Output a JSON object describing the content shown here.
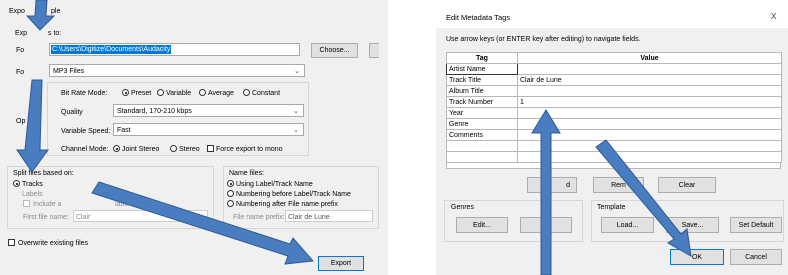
{
  "export_dialog": {
    "title_visible": "Expo",
    "title_tail": "ple",
    "export_to_label_visible": "Exp",
    "export_to_label_tail": "s to:",
    "path_value": "C:\\Users\\Digitize\\Documents\\Audacity",
    "choose_button": "Choose...",
    "format_label": "Fo",
    "format_value": "MP3 Files",
    "format_label_2": "Fo",
    "options_label": "Op",
    "bitrate_label": "Bit Rate Mode:",
    "bitrate_options": [
      "Preset",
      "Variable",
      "Average",
      "Constant"
    ],
    "quality_label": "Quality",
    "quality_value": "Standard, 170-210 kbps",
    "speed_label": "Variable Speed:",
    "speed_value": "Fast",
    "channel_label": "Channel Mode:",
    "channel_options": [
      "Joint Stereo",
      "Stereo"
    ],
    "force_mono_label": "Force export to mono",
    "split_label": "Split files based on:",
    "split_tracks": "Tracks",
    "split_labels": "Labels",
    "include_label": "Include a",
    "include_label_tail": "label",
    "first_file_name_label": "First file name:",
    "first_file_name_value": "Clair",
    "name_files_label": "Name files:",
    "name_options": [
      "Using Label/Track Name",
      "Numbering before Label/Track Name",
      "Numbering after File name prefix"
    ],
    "prefix_label": "File name prefix:",
    "prefix_value": "Clair de Lune",
    "overwrite_label": "Overwrite existing files",
    "export_button": "Export"
  },
  "metadata_dialog": {
    "title": "Edit Metadata Tags",
    "close_symbol": "X",
    "instruction": "Use arrow keys (or ENTER key after editing) to navigate fields.",
    "columns": [
      "Tag",
      "Value"
    ],
    "rows": [
      {
        "tag": "Artist Name",
        "value": ""
      },
      {
        "tag": "Track Title",
        "value": "Clair de Lune"
      },
      {
        "tag": "Album Title",
        "value": ""
      },
      {
        "tag": "Track Number",
        "value": "1"
      },
      {
        "tag": "Year",
        "value": ""
      },
      {
        "tag": "Genre",
        "value": ""
      },
      {
        "tag": "Comments",
        "value": ""
      },
      {
        "tag": "",
        "value": ""
      },
      {
        "tag": "",
        "value": ""
      }
    ],
    "add_button_partial": "d",
    "remove_button_partial": "Rem",
    "clear_button": "Clear",
    "genres_label": "Genres",
    "genres_edit": "Edit...",
    "genres_reset_partial": "",
    "template_label": "Template",
    "load_button": "Load...",
    "save_button_partial": "Save...",
    "set_default_button": "Set Default",
    "ok_button": "OK",
    "cancel_button": "Cancel"
  },
  "colors": {
    "arrow_fill": "#4a7cc0",
    "arrow_stroke": "#2e5a96",
    "selection": "#0078d7",
    "panel": "#f0f0f0"
  }
}
